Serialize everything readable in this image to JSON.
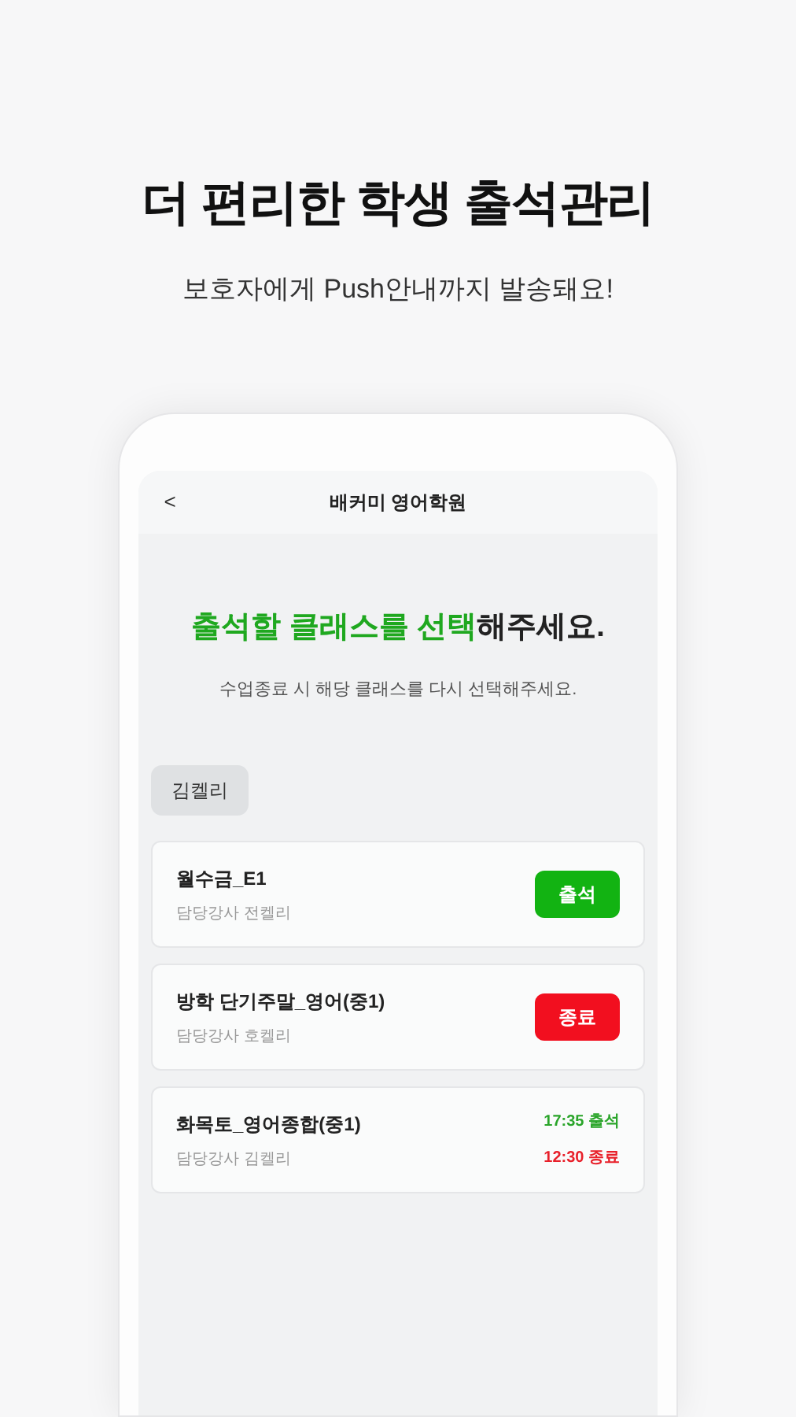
{
  "headline": "더 편리한 학생 출석관리",
  "subheadline": "보호자에게 Push안내까지 발송돼요!",
  "app": {
    "back": "<",
    "title": "배커미 영어학원",
    "prompt": {
      "highlight": "출석할 클래스를 선택",
      "rest": "해주세요."
    },
    "hint": "수업종료 시 해당 클래스를 다시 선택해주세요.",
    "student": "김켈리",
    "classes": [
      {
        "name": "월수금_E1",
        "teacher": "담당강사 전켈리",
        "kind": "button",
        "action": {
          "label": "출석",
          "kind": "in"
        }
      },
      {
        "name": "방학 단기주말_영어(중1)",
        "teacher": "담당강사 호켈리",
        "kind": "button",
        "action": {
          "label": "종료",
          "kind": "out"
        }
      },
      {
        "name": "화목토_영어종합(중1)",
        "teacher": "담당강사 김켈리",
        "kind": "records",
        "records": [
          {
            "text": "17:35 출석",
            "kind": "in"
          },
          {
            "text": "12:30 종료",
            "kind": "out"
          }
        ]
      }
    ]
  }
}
